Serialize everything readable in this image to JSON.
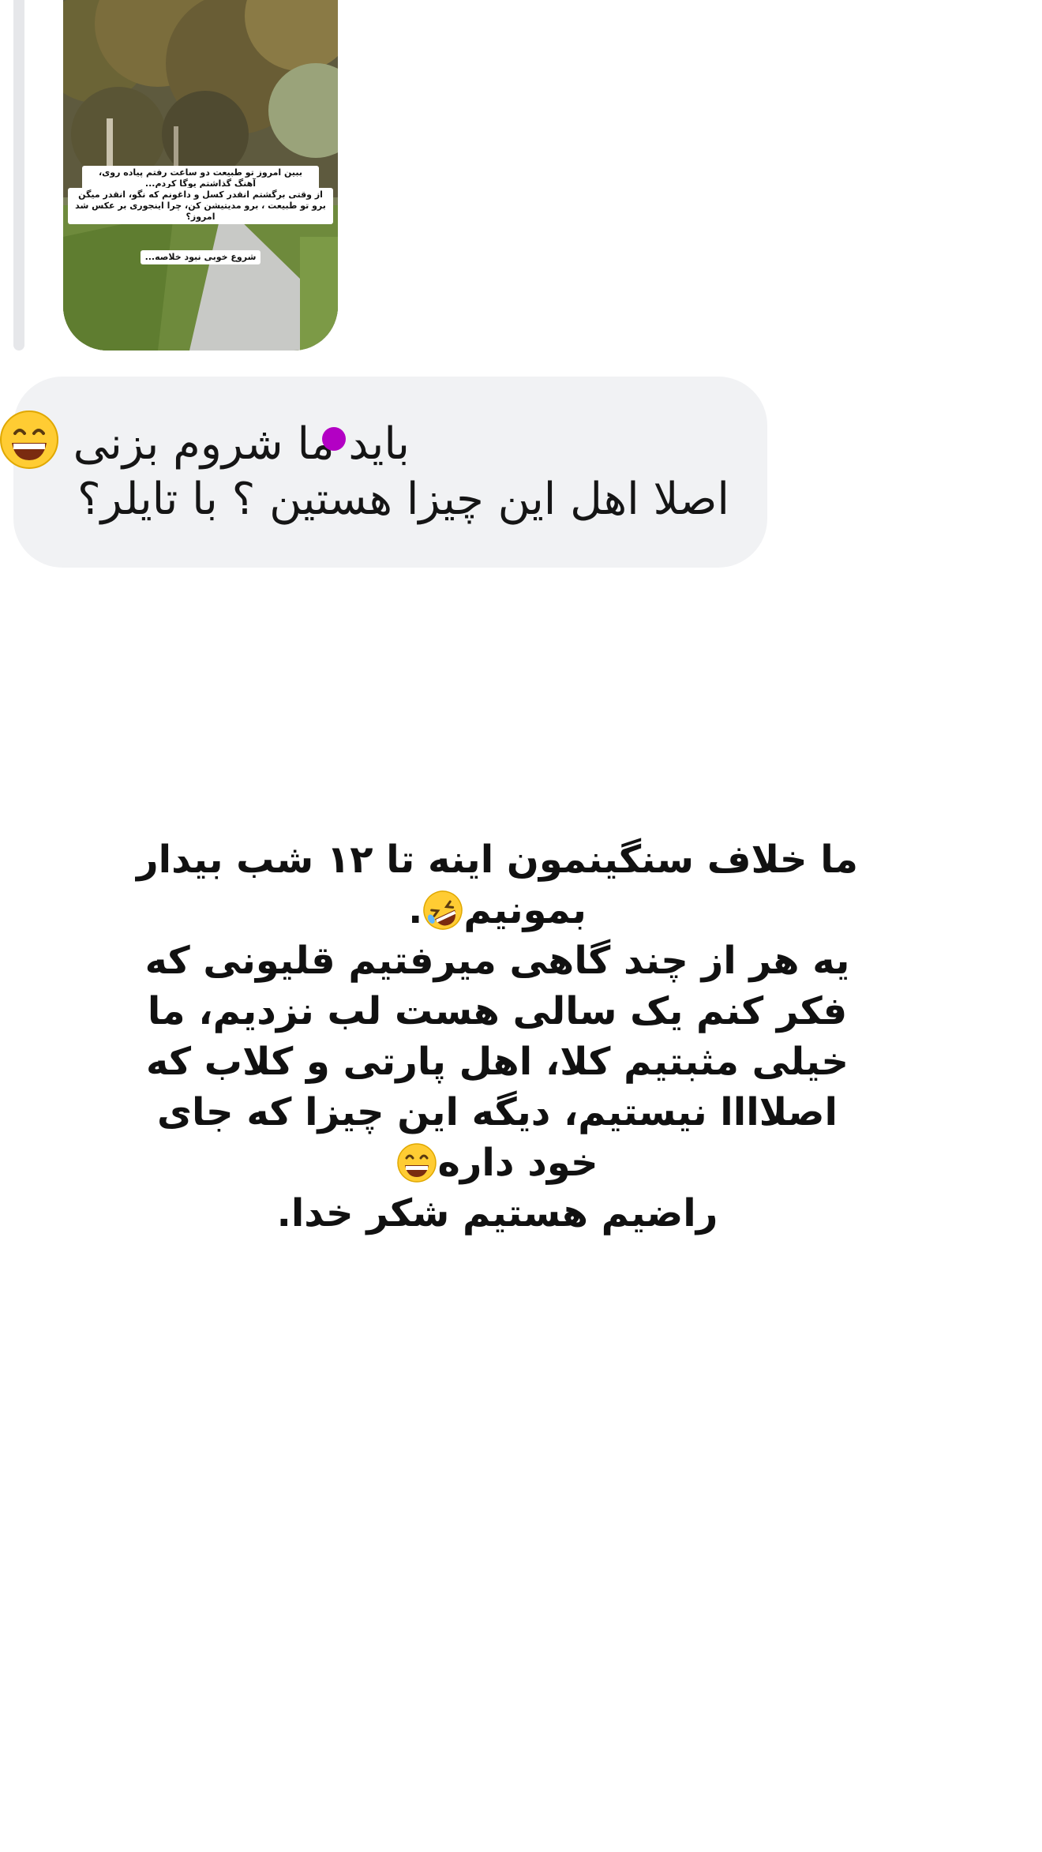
{
  "story_reply": {
    "caption_lines": [
      "ببین امروز تو طبیعت دو ساعت رفتم پیاده روی، آهنگ گذاشتم یوگا کردم...",
      "از وقتی برگشتم انقدر کسل و داغونم که نگو، انقدر میگن برو تو طبیعت ، برو مدیتیشن کن، چرا اینجوری بر عکس شد امروز؟",
      "شروع خوبی نبود خلاصه..."
    ]
  },
  "message": {
    "line1": "باید ما شروم بزنی",
    "line2": "اصلا اهل این چیزا هستین ؟ با تایلر؟",
    "emoji": "grinning-face-icon",
    "dot_color": "#b300c4"
  },
  "story_text": {
    "p1": "ما خلاف سنگینمون اینه تا ۱۲ شب بیدار بمونیم",
    "p1_emoji": "rolling-on-floor-laughing-icon",
    "p2": "یه هر از چند گاهی میرفتیم قلیونی که فکر کنم یک سالی هست لب نزدیم، ما خیلی مثبتیم کلا، اهل پارتی و کلاب که اصلاااا نیستیم، دیگه این چیزا که جای خود داره",
    "p2_emoji": "grinning-face-icon",
    "p3": "راضیم هستیم شکر خدا."
  },
  "colors": {
    "bubble_bg": "#f1f2f4",
    "text": "#111111"
  }
}
